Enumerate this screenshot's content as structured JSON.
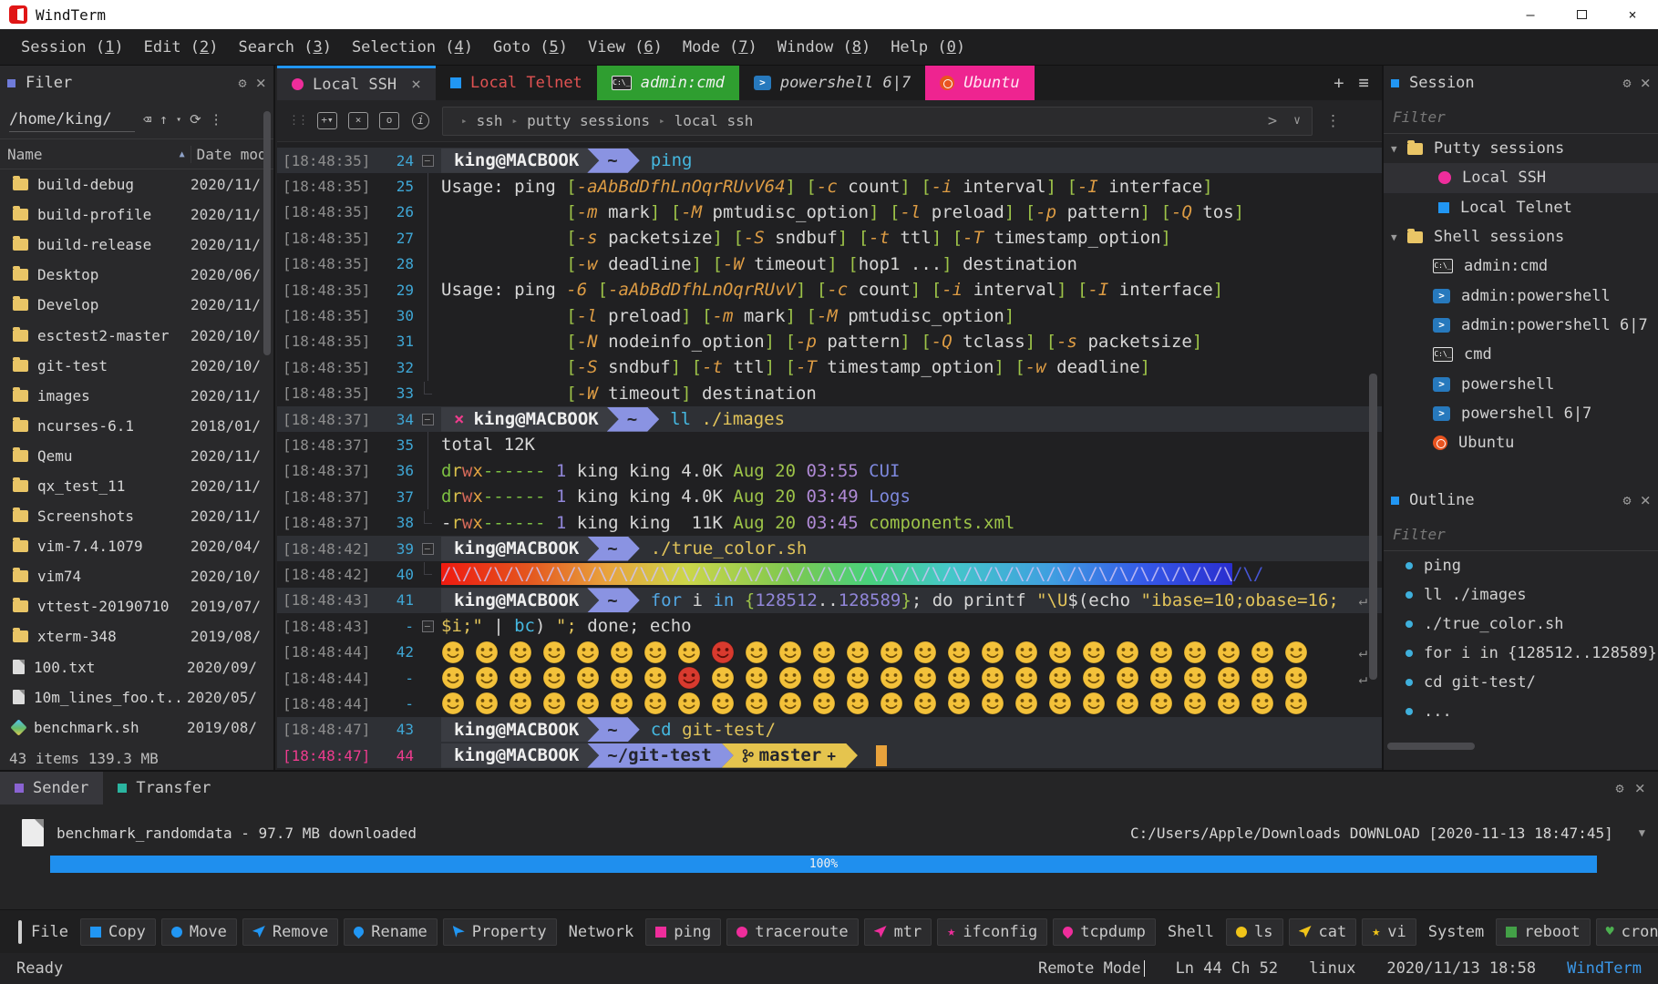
{
  "window": {
    "title": "WindTerm",
    "minimize": "—",
    "close": "×"
  },
  "menu": {
    "items": [
      {
        "label": "Session",
        "mnemonic": "1"
      },
      {
        "label": "Edit",
        "mnemonic": "2"
      },
      {
        "label": "Search",
        "mnemonic": "3"
      },
      {
        "label": "Selection",
        "mnemonic": "4"
      },
      {
        "label": "Goto",
        "mnemonic": "5"
      },
      {
        "label": "View",
        "mnemonic": "6"
      },
      {
        "label": "Mode",
        "mnemonic": "7"
      },
      {
        "label": "Window",
        "mnemonic": "8"
      },
      {
        "label": "Help",
        "mnemonic": "0"
      }
    ]
  },
  "filer": {
    "title": "Filer",
    "path": "/home/king/",
    "columns": {
      "name": "Name",
      "date": "Date mod"
    },
    "items": [
      {
        "name": "build-debug",
        "date": "2020/11/",
        "icon": "folder"
      },
      {
        "name": "build-profile",
        "date": "2020/11/",
        "icon": "folder"
      },
      {
        "name": "build-release",
        "date": "2020/11/",
        "icon": "folder"
      },
      {
        "name": "Desktop",
        "date": "2020/06/",
        "icon": "folder"
      },
      {
        "name": "Develop",
        "date": "2020/11/",
        "icon": "folder"
      },
      {
        "name": "esctest2-master",
        "date": "2020/10/",
        "icon": "folder"
      },
      {
        "name": "git-test",
        "date": "2020/10/",
        "icon": "folder"
      },
      {
        "name": "images",
        "date": "2020/11/",
        "icon": "folder"
      },
      {
        "name": "ncurses-6.1",
        "date": "2018/01/",
        "icon": "folder"
      },
      {
        "name": "Qemu",
        "date": "2020/11/",
        "icon": "folder"
      },
      {
        "name": "qx_test_11",
        "date": "2020/11/",
        "icon": "folder"
      },
      {
        "name": "Screenshots",
        "date": "2020/11/",
        "icon": "folder"
      },
      {
        "name": "vim-7.4.1079",
        "date": "2020/04/",
        "icon": "folder"
      },
      {
        "name": "vim74",
        "date": "2020/10/",
        "icon": "folder"
      },
      {
        "name": "vttest-20190710",
        "date": "2019/07/",
        "icon": "folder"
      },
      {
        "name": "xterm-348",
        "date": "2019/08/",
        "icon": "folder"
      },
      {
        "name": "100.txt",
        "date": "2020/09/",
        "icon": "file"
      },
      {
        "name": "10m_lines_foo.t..",
        "date": "2020/05/",
        "icon": "file"
      },
      {
        "name": "benchmark.sh",
        "date": "2019/08/",
        "icon": "gem"
      }
    ],
    "status": "43 items 139.3 MB"
  },
  "tabs": {
    "items": [
      {
        "label": "Local SSH",
        "type": "dot",
        "color": "#ee2d9b",
        "active": true,
        "close": "×"
      },
      {
        "label": "Local Telnet",
        "type": "square",
        "color": "#2196f3",
        "label_color": "#e05252"
      },
      {
        "label": "admin:cmd",
        "type": "cmd",
        "bg": "#2f9e30",
        "italic": true,
        "label_color": "#f0f0f0"
      },
      {
        "label": "powershell 6|7",
        "type": "ps",
        "italic": true,
        "label_color": "#c9c9c9"
      },
      {
        "label": "Ubuntu",
        "type": "ubuntu",
        "bg": "#ee2490",
        "italic": true,
        "label_color": "#ffe8f4"
      }
    ],
    "add": "+",
    "menu": "≡"
  },
  "termbar": {
    "breadcrumb": [
      "ssh",
      "putty sessions",
      "local ssh"
    ]
  },
  "terminal": {
    "host": "king@MACBOOK",
    "git_plus": "+",
    "wrap_symbol": "↵",
    "rainbow_pattern": "/\\",
    "rainbow_tail": "/\\/",
    "lines": [
      {
        "ts": "[18:48:35]",
        "n": "24",
        "fold": "box",
        "hl": true,
        "prompt": {
          "path": "~"
        },
        "cmd": [
          [
            "ping",
            "cy"
          ]
        ]
      },
      {
        "ts": "[18:48:35]",
        "n": "25",
        "fold": "bar",
        "usage": "Usage: ping [-aAbBdDfhLnOqrRUvV64] [-c count] [-i interval] [-I interface]"
      },
      {
        "ts": "[18:48:35]",
        "n": "26",
        "fold": "bar",
        "usage": "            [-m mark] [-M pmtudisc_option] [-l preload] [-p pattern] [-Q tos]"
      },
      {
        "ts": "[18:48:35]",
        "n": "27",
        "fold": "bar",
        "usage": "            [-s packetsize] [-S sndbuf] [-t ttl] [-T timestamp_option]"
      },
      {
        "ts": "[18:48:35]",
        "n": "28",
        "fold": "bar",
        "usage": "            [-w deadline] [-W timeout] [hop1 ...] destination"
      },
      {
        "ts": "[18:48:35]",
        "n": "29",
        "fold": "bar",
        "usage": "Usage: ping -6 [-aAbBdDfhLnOqrRUvV] [-c count] [-i interval] [-I interface]"
      },
      {
        "ts": "[18:48:35]",
        "n": "30",
        "fold": "bar",
        "usage": "            [-l preload] [-m mark] [-M pmtudisc_option]"
      },
      {
        "ts": "[18:48:35]",
        "n": "31",
        "fold": "bar",
        "usage": "            [-N nodeinfo_option] [-p pattern] [-Q tclass] [-s packetsize]"
      },
      {
        "ts": "[18:48:35]",
        "n": "32",
        "fold": "bar",
        "usage": "            [-S sndbuf] [-t ttl] [-T timestamp_option] [-w deadline]"
      },
      {
        "ts": "[18:48:35]",
        "n": "33",
        "fold": "end",
        "usage": "            [-W timeout] destination"
      },
      {
        "ts": "[18:48:37]",
        "n": "34",
        "fold": "box",
        "hl": true,
        "err": true,
        "prompt": {
          "path": "~"
        },
        "cmd": [
          [
            "ll",
            "cy"
          ],
          [
            " ./images",
            "yl"
          ]
        ]
      },
      {
        "ts": "[18:48:37]",
        "n": "35",
        "fold": "bar",
        "segs": [
          [
            "total 12K",
            "w"
          ]
        ]
      },
      {
        "ts": "[18:48:37]",
        "n": "36",
        "fold": "bar",
        "segs": [
          [
            "d",
            "dgrn"
          ],
          [
            "r",
            "ylw2"
          ],
          [
            "w",
            "redc"
          ],
          [
            "x",
            "orgx"
          ],
          [
            "------",
            "dgrn"
          ],
          [
            " ",
            "w"
          ],
          [
            "1",
            "num"
          ],
          [
            " king king ",
            "w"
          ],
          [
            "4.0K",
            "w"
          ],
          [
            " ",
            "w"
          ],
          [
            "Aug 20",
            "grn"
          ],
          [
            " ",
            "w"
          ],
          [
            "03:55",
            "pud"
          ],
          [
            " ",
            "w"
          ],
          [
            "CUI",
            "dirb"
          ]
        ]
      },
      {
        "ts": "[18:48:37]",
        "n": "37",
        "fold": "bar",
        "segs": [
          [
            "d",
            "dgrn"
          ],
          [
            "r",
            "ylw2"
          ],
          [
            "w",
            "redc"
          ],
          [
            "x",
            "orgx"
          ],
          [
            "------",
            "dgrn"
          ],
          [
            " ",
            "w"
          ],
          [
            "1",
            "num"
          ],
          [
            " king king ",
            "w"
          ],
          [
            "4.0K",
            "w"
          ],
          [
            " ",
            "w"
          ],
          [
            "Aug 20",
            "grn"
          ],
          [
            " ",
            "w"
          ],
          [
            "03:49",
            "pud"
          ],
          [
            " ",
            "w"
          ],
          [
            "Logs",
            "dirb"
          ]
        ]
      },
      {
        "ts": "[18:48:37]",
        "n": "38",
        "fold": "end",
        "segs": [
          [
            "-",
            "w"
          ],
          [
            "r",
            "ylw2"
          ],
          [
            "w",
            "redc"
          ],
          [
            "x",
            "orgx"
          ],
          [
            "------",
            "dgrn"
          ],
          [
            " ",
            "w"
          ],
          [
            "1",
            "num"
          ],
          [
            " king king  ",
            "w"
          ],
          [
            "11K",
            "w"
          ],
          [
            " ",
            "w"
          ],
          [
            "Aug 20",
            "grn"
          ],
          [
            " ",
            "w"
          ],
          [
            "03:45",
            "pud"
          ],
          [
            " ",
            "w"
          ],
          [
            "components.xml",
            "grn"
          ]
        ]
      },
      {
        "ts": "[18:48:42]",
        "n": "39",
        "fold": "box",
        "hl": true,
        "prompt": {
          "path": "~"
        },
        "cmd": [
          [
            "./true_color.sh",
            "yl"
          ]
        ]
      },
      {
        "ts": "[18:48:42]",
        "n": "40",
        "fold": "end",
        "rainbow": true
      },
      {
        "ts": "[18:48:43]",
        "n": "41",
        "hl": true,
        "prompt": {
          "path": "~"
        },
        "cmd": [
          [
            "for",
            "kw"
          ],
          [
            " i ",
            "w"
          ],
          [
            "in",
            "kw"
          ],
          [
            " ",
            "w"
          ],
          [
            "{",
            "grn"
          ],
          [
            "128512",
            "num"
          ],
          [
            "..",
            "w"
          ],
          [
            "128589",
            "num"
          ],
          [
            "}",
            "grn"
          ],
          [
            "; do printf ",
            "w"
          ],
          [
            "\"\\U",
            "yl"
          ],
          [
            "$(echo ",
            "w"
          ],
          [
            "\"ibase=10;obase=16;",
            "yl"
          ]
        ],
        "wrap": true
      },
      {
        "ts": "[18:48:43]",
        "n": "-",
        "fold": "box",
        "segs": [
          [
            "$i;\"",
            "yl"
          ],
          [
            " | ",
            "w"
          ],
          [
            "bc",
            "cy"
          ],
          [
            ") ",
            "w"
          ],
          [
            "\"; ",
            "yl"
          ],
          [
            "done",
            "w"
          ],
          [
            "; echo",
            "w"
          ]
        ]
      },
      {
        "ts": "[18:48:44]",
        "n": "42",
        "emojis": "😀😁😂😃😄😅😆😇😈😉😊😋😌😍😎😏😐😑😒😓😔😕😖😗😘😙",
        "wrap": true
      },
      {
        "ts": "[18:48:44]",
        "n": "-",
        "emojis": "😚😛😜😝😞😟😠😡😢😣😤😥😦😧😨😩😪😫😬😭😮😯😰😱😲😳",
        "wrap": true
      },
      {
        "ts": "[18:48:44]",
        "n": "-",
        "emojis": "😴😵😶😷😸😹😺😻😼😽😾😿🙀🙁🙂🙃🙄🙅🙆🙇🙈🙉🙊🙋🙌🙍"
      },
      {
        "ts": "[18:48:47]",
        "n": "43",
        "hl": true,
        "prompt": {
          "path": "~"
        },
        "cmd": [
          [
            "cd",
            "cy"
          ],
          [
            " git-test/",
            "yl"
          ]
        ]
      },
      {
        "ts": "[18:48:47]",
        "n": "44",
        "hl": true,
        "mag": true,
        "prompt": {
          "path": "~/git-test",
          "git": "master"
        },
        "cursor": true
      }
    ]
  },
  "session_panel": {
    "title": "Session",
    "filter_placeholder": "Filter",
    "groups": [
      {
        "label": "Putty sessions",
        "items": [
          {
            "label": "Local SSH",
            "icon": "dot",
            "color": "#ee2d9b",
            "selected": true
          },
          {
            "label": "Local Telnet",
            "icon": "square",
            "color": "#2196f3"
          }
        ]
      },
      {
        "label": "Shell sessions",
        "items": [
          {
            "label": "admin:cmd",
            "icon": "cmd"
          },
          {
            "label": "admin:powershell",
            "icon": "ps"
          },
          {
            "label": "admin:powershell 6|7",
            "icon": "ps"
          },
          {
            "label": "cmd",
            "icon": "cmd"
          },
          {
            "label": "powershell",
            "icon": "ps"
          },
          {
            "label": "powershell 6|7",
            "icon": "ps"
          },
          {
            "label": "Ubuntu",
            "icon": "ubuntu"
          }
        ]
      }
    ]
  },
  "outline_panel": {
    "title": "Outline",
    "filter_placeholder": "Filter",
    "items": [
      "ping",
      "ll ./images",
      "./true_color.sh",
      "for i in {128512..128589}",
      "cd git-test/",
      "..."
    ]
  },
  "transfer_panel": {
    "tabs": [
      {
        "label": "Sender",
        "color": "#8a63d2",
        "active": true
      },
      {
        "label": "Transfer",
        "color": "#2bb5a0"
      }
    ],
    "file_label": "benchmark_randomdata - 97.7 MB downloaded",
    "destination": "C:/Users/Apple/Downloads DOWNLOAD [2020-11-13 18:47:45]",
    "progress_percent": "100%"
  },
  "bottom_toolbar": {
    "items": [
      {
        "label": "File"
      },
      {
        "label": "Copy",
        "icon": "square",
        "color": "#2196f3"
      },
      {
        "label": "Move",
        "icon": "circle",
        "color": "#2196f3"
      },
      {
        "label": "Remove",
        "icon": "plane",
        "color": "#2196f3"
      },
      {
        "label": "Rename",
        "icon": "drop",
        "color": "#2196f3"
      },
      {
        "label": "Property",
        "icon": "cursor",
        "color": "#2196f3"
      },
      {
        "label": "Network"
      },
      {
        "label": "ping",
        "icon": "square",
        "color": "#ee2d9b"
      },
      {
        "label": "traceroute",
        "icon": "circle",
        "color": "#ee2d9b"
      },
      {
        "label": "mtr",
        "icon": "plane",
        "color": "#ee2d9b"
      },
      {
        "label": "ifconfig",
        "icon": "star",
        "color": "#ee2d9b"
      },
      {
        "label": "tcpdump",
        "icon": "pin",
        "color": "#ee2d9b"
      },
      {
        "label": "Shell"
      },
      {
        "label": "ls",
        "icon": "circle",
        "color": "#f0c419"
      },
      {
        "label": "cat",
        "icon": "plane",
        "color": "#f0c419"
      },
      {
        "label": "vi",
        "icon": "star",
        "color": "#f0c419"
      },
      {
        "label": "System"
      },
      {
        "label": "reboot",
        "icon": "square",
        "color": "#43a047"
      },
      {
        "label": "crontab",
        "icon": "heart",
        "color": "#4caf50"
      }
    ]
  },
  "statusbar": {
    "ready": "Ready",
    "mode": "Remote Mode",
    "position": "Ln 44 Ch 52",
    "os": "linux",
    "datetime": "2020/11/13 18:58",
    "brand": "WindTerm"
  },
  "colors": {
    "accent": "#2196f3",
    "magenta": "#ee2d9b",
    "progress": "#1f8fee"
  }
}
